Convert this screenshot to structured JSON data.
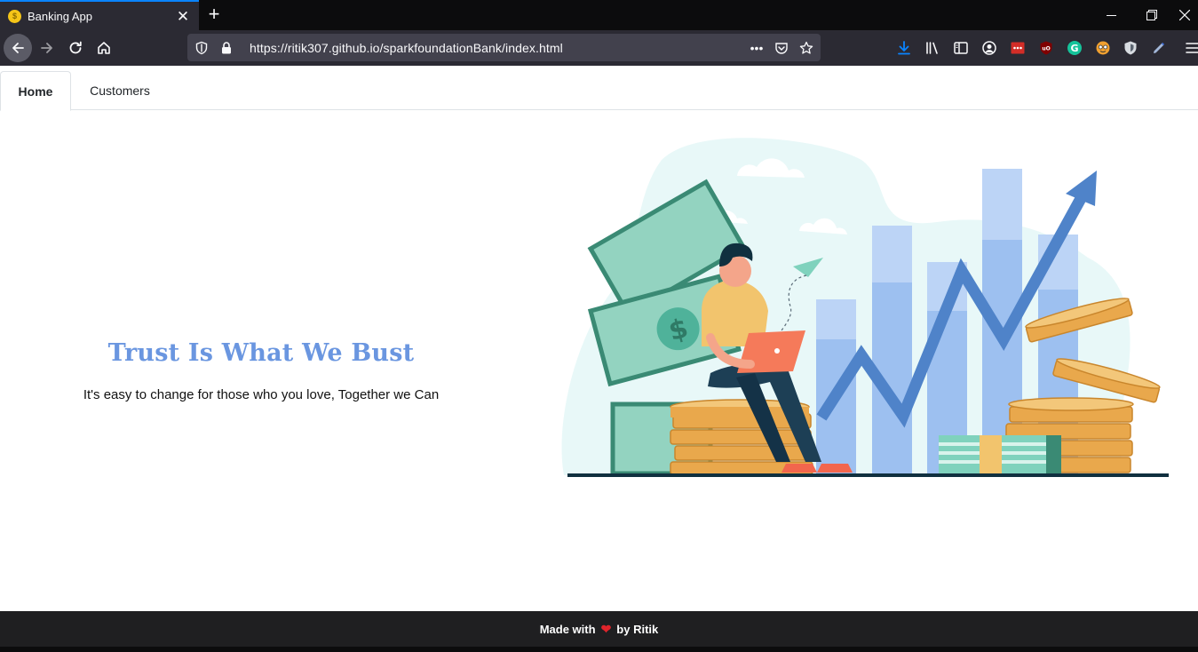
{
  "browser": {
    "tab_title": "Banking App",
    "url": "https://ritik307.github.io/sparkfoundationBank/index.html",
    "url_more": "•••"
  },
  "nav_tabs": [
    {
      "label": "Home",
      "active": true
    },
    {
      "label": "Customers",
      "active": false
    }
  ],
  "hero": {
    "title": "Trust Is What We Bust",
    "subtitle": "It's easy to change for those who you love, Together we Can"
  },
  "footer": {
    "prefix": "Made with",
    "heart": "❤",
    "suffix": "by Ritik"
  },
  "colors": {
    "accent": "#0a84ff",
    "title": "#6a96e0",
    "footer_bg": "#1f1f21"
  }
}
